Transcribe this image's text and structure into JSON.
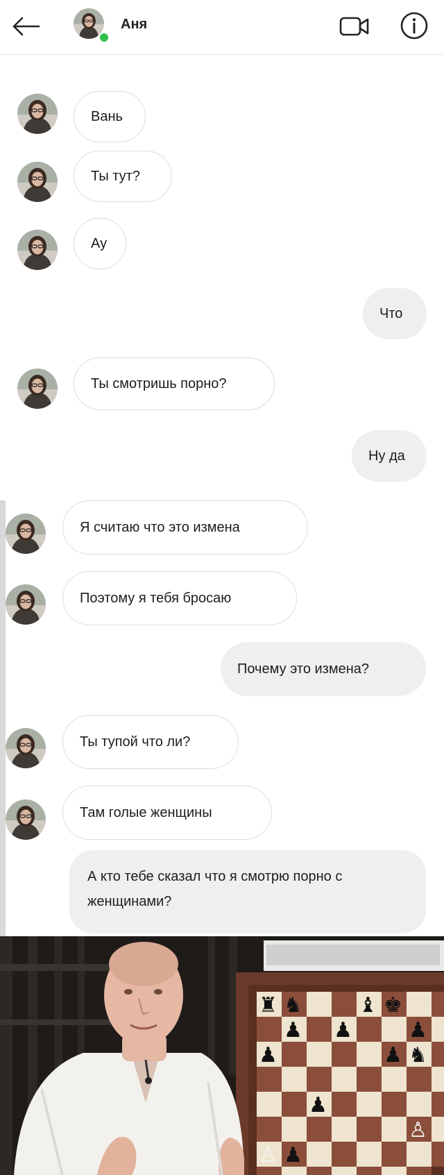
{
  "header": {
    "contact_name": "Аня",
    "back_icon": "back-arrow-icon",
    "video_icon": "video-camera-icon",
    "info_icon": "info-icon",
    "online_color": "#2fbf4b"
  },
  "messages": [
    {
      "side": "in",
      "text": "Вань"
    },
    {
      "side": "in",
      "text": "Ты тут?"
    },
    {
      "side": "in",
      "text": "Ау"
    },
    {
      "side": "out",
      "text": "Что"
    },
    {
      "side": "in",
      "text": "Ты смотришь порно?"
    },
    {
      "side": "out",
      "text": "Ну да"
    },
    {
      "side": "in",
      "text": "Я считаю что это измена"
    },
    {
      "side": "in",
      "text": "Поэтому я тебя бросаю"
    },
    {
      "side": "out",
      "text": "Почему это измена?"
    },
    {
      "side": "in",
      "text": "Ты тупой что ли?"
    },
    {
      "side": "in",
      "text": "Там голые женщины"
    },
    {
      "side": "out",
      "text": "А кто тебе сказал что я смотрю порно с женщинами?"
    }
  ],
  "colors": {
    "incoming_bubble": "#ffffff",
    "outgoing_bubble": "#efefef",
    "chessboard_light": "#efe4cf",
    "chessboard_dark": "#8a4e3a"
  },
  "photo": {
    "subject": "man-in-front-of-chessboard",
    "chess_pieces": [
      "rook",
      "knight",
      "bishop",
      "king",
      "pawn"
    ]
  }
}
